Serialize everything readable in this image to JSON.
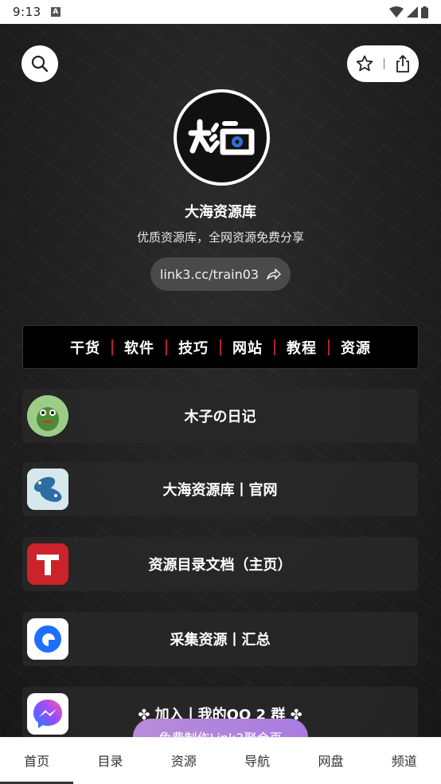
{
  "status_bar": {
    "time": "9:13",
    "notification_icon": "A"
  },
  "profile": {
    "name": "大海资源库",
    "description": "优质资源库，全网资源免费分享",
    "link": "link3.cc/train03"
  },
  "banner": {
    "words": [
      "干货",
      "软件",
      "技巧",
      "网站",
      "教程",
      "资源"
    ]
  },
  "links": [
    {
      "label": "木子の日记",
      "icon": "frog-avatar-icon"
    },
    {
      "label": "大海资源库丨官网",
      "icon": "fish-logo-icon"
    },
    {
      "label": "资源目录文档（主页）",
      "icon": "t-logo-icon"
    },
    {
      "label": "采集资源丨汇总",
      "icon": "blue-ring-logo-icon"
    },
    {
      "label": "✤ 加入丨我的QQ 2 群 ✤",
      "icon": "messenger-icon"
    }
  ],
  "cta": {
    "label": "免费制作Link3聚合页"
  },
  "tabs": [
    {
      "label": "首页",
      "active": true
    },
    {
      "label": "目录",
      "active": false
    },
    {
      "label": "资源",
      "active": false
    },
    {
      "label": "导航",
      "active": false
    },
    {
      "label": "网盘",
      "active": false
    },
    {
      "label": "频道",
      "active": false
    }
  ],
  "colors": {
    "banner_divider": "#b8202a",
    "cta_gradient_start": "#b98bd9",
    "cta_gradient_end": "#a77ce0"
  }
}
